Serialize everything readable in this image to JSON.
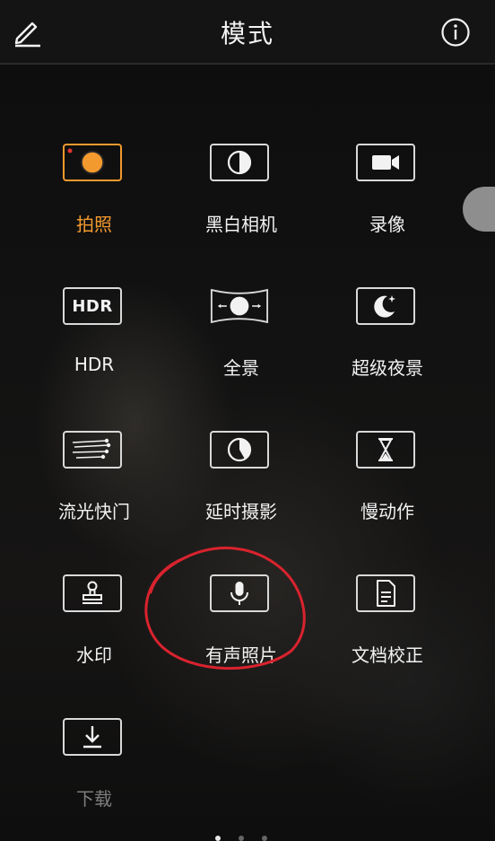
{
  "header": {
    "title": "模式"
  },
  "icons": {
    "edit": "pencil-edit-icon",
    "info": "info-circle-icon"
  },
  "colors": {
    "accent": "#f39a2e",
    "annotation": "#d9232e",
    "text": "#f2f2f2",
    "dimmed_text": "#7d7d7d"
  },
  "modes": [
    {
      "label": "拍照",
      "icon": "photo-shutter-icon",
      "active": true
    },
    {
      "label": "黑白相机",
      "icon": "black-white-icon"
    },
    {
      "label": "录像",
      "icon": "video-camera-icon"
    },
    {
      "label": "HDR",
      "icon": "hdr-icon",
      "icon_text": "HDR"
    },
    {
      "label": "全景",
      "icon": "panorama-icon"
    },
    {
      "label": "超级夜景",
      "icon": "night-moon-icon"
    },
    {
      "label": "流光快门",
      "icon": "light-trail-icon"
    },
    {
      "label": "延时摄影",
      "icon": "time-lapse-icon"
    },
    {
      "label": "慢动作",
      "icon": "hourglass-icon"
    },
    {
      "label": "水印",
      "icon": "stamp-icon"
    },
    {
      "label": "有声照片",
      "icon": "microphone-icon",
      "circled": true
    },
    {
      "label": "文档校正",
      "icon": "document-icon"
    },
    {
      "label": "下载",
      "icon": "download-icon",
      "dimmed": true
    }
  ],
  "pagination": {
    "pages": 3,
    "current": 1
  }
}
